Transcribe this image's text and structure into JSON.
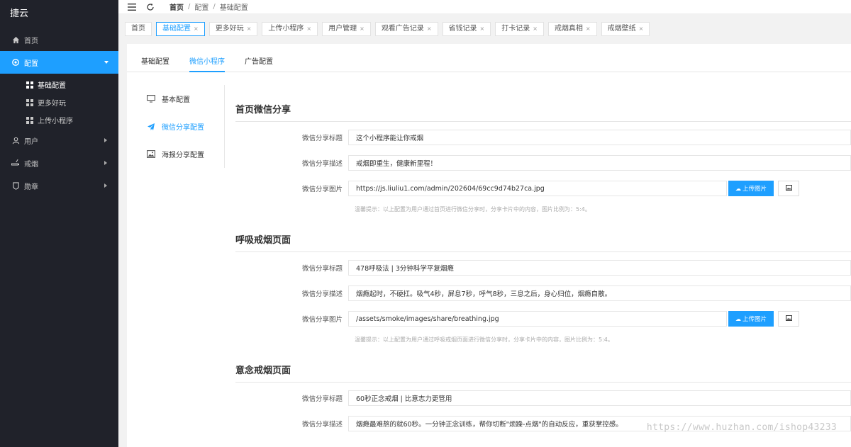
{
  "brand": "捷云",
  "sidebar": {
    "items": [
      {
        "label": "首页",
        "icon": "home-icon"
      },
      {
        "label": "配置",
        "icon": "gear-icon",
        "active": true,
        "children": [
          {
            "label": "基础配置",
            "active": true
          },
          {
            "label": "更多好玩"
          },
          {
            "label": "上传小程序"
          }
        ]
      },
      {
        "label": "用户",
        "icon": "user-icon"
      },
      {
        "label": "戒烟",
        "icon": "smoking-icon"
      },
      {
        "label": "勋章",
        "icon": "medal-icon"
      }
    ]
  },
  "breadcrumb": [
    "首页",
    "配置",
    "基础配置"
  ],
  "tabs": [
    {
      "label": "首页",
      "closable": false
    },
    {
      "label": "基础配置",
      "active": true,
      "closable": true
    },
    {
      "label": "更多好玩",
      "closable": true
    },
    {
      "label": "上传小程序",
      "closable": true
    },
    {
      "label": "用户管理",
      "closable": true
    },
    {
      "label": "观看广告记录",
      "closable": true
    },
    {
      "label": "省钱记录",
      "closable": true
    },
    {
      "label": "打卡记录",
      "closable": true
    },
    {
      "label": "戒烟真相",
      "closable": true
    },
    {
      "label": "戒烟壁纸",
      "closable": true
    }
  ],
  "subtabs": [
    "基础配置",
    "微信小程序",
    "广告配置"
  ],
  "leftnav": [
    {
      "label": "基本配置",
      "icon": "monitor-icon"
    },
    {
      "label": "微信分享配置",
      "icon": "send-icon",
      "active": true
    },
    {
      "label": "海报分享配置",
      "icon": "image-icon"
    }
  ],
  "labels": {
    "title": "微信分享标题",
    "desc": "微信分享描述",
    "image": "微信分享图片",
    "upload": "上传图片"
  },
  "sections": [
    {
      "title": "首页微信分享",
      "share_title": "这个小程序能让你戒烟",
      "share_desc": "戒烟即重生，健康新里程！",
      "share_image": "https://js.liuliu1.com/admin/202604/69cc9d74b27ca.jpg",
      "hint": "温馨提示：以上配置为用户通过首页进行微信分享时，分享卡片中的内容，图片比例为：5:4。"
    },
    {
      "title": "呼吸戒烟页面",
      "share_title": "478呼吸法 | 3分钟科学平复烟瘾",
      "share_desc": "烟瘾起时，不硬扛。吸气4秒，屏息7秒，呼气8秒，三息之后，身心归位，烟瘾自散。",
      "share_image": "/assets/smoke/images/share/breathing.jpg",
      "hint": "温馨提示：以上配置为用户通过呼吸戒烟页面进行微信分享时，分享卡片中的内容，图片比例为：5:4。"
    },
    {
      "title": "意念戒烟页面",
      "share_title": "60秒正念戒烟 | 比意志力更管用",
      "share_desc": "烟瘾最难熬的就60秒。一分钟正念训练，帮你切断\"烦躁-点烟\"的自动反应，重获掌控感。"
    }
  ],
  "watermark": "https://www.huzhan.com/ishop43233"
}
